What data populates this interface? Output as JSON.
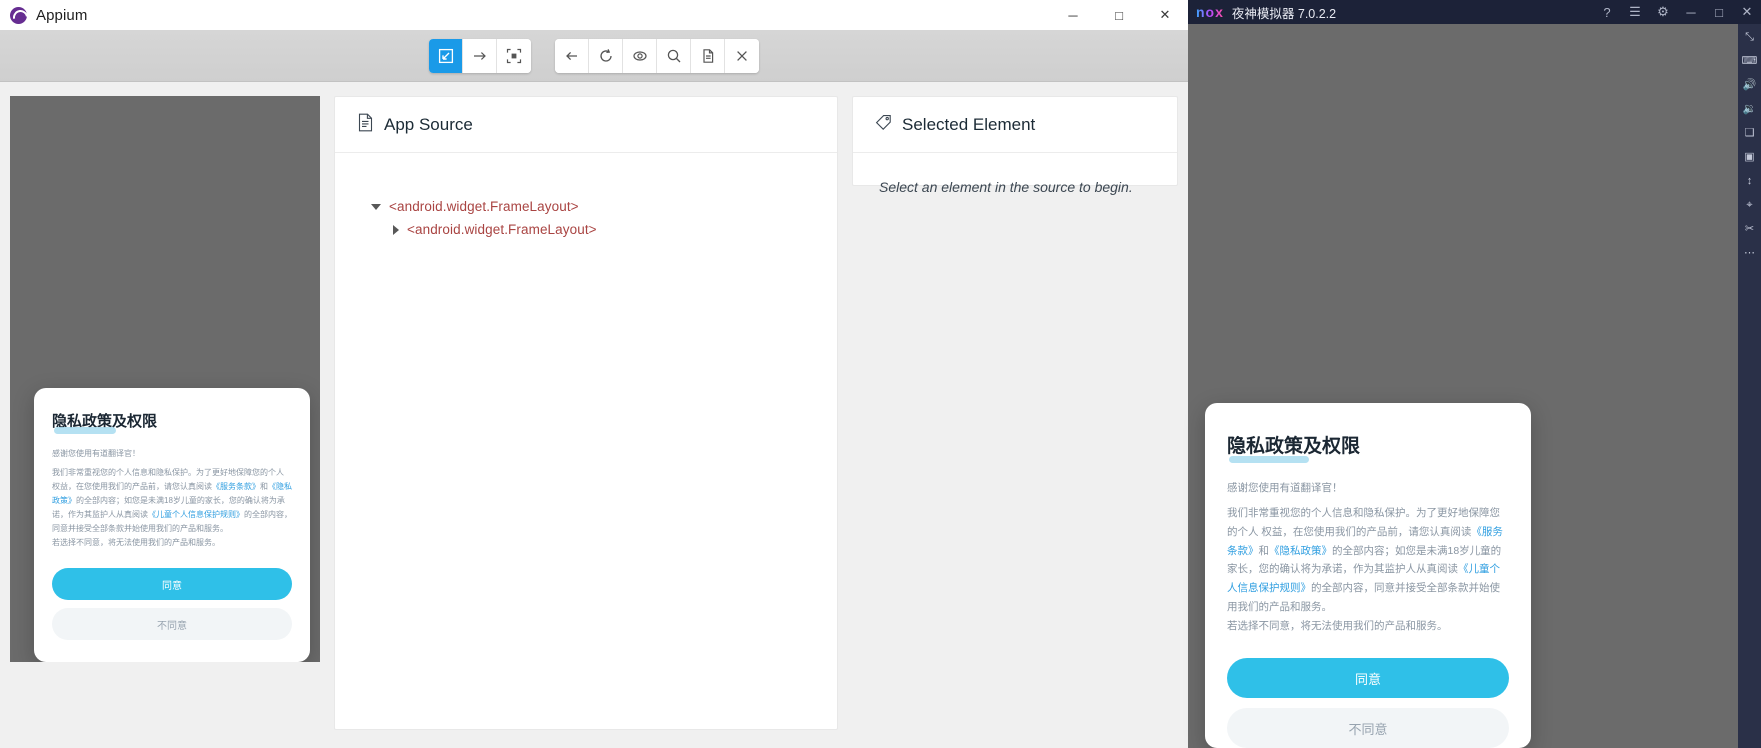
{
  "appium": {
    "window_title": "Appium",
    "logo_icon": "appium-logo-icon",
    "window_controls": {
      "minimize": "─",
      "maximize": "□",
      "close": "✕"
    },
    "toolbar": {
      "groups": [
        [
          {
            "name": "select-element-button",
            "icon": "select-arrow-icon",
            "active": true
          },
          {
            "name": "swipe-button",
            "icon": "arrow-right-icon",
            "active": false
          },
          {
            "name": "tap-by-coordinates-button",
            "icon": "crosshair-frame-icon",
            "active": false
          }
        ],
        [
          {
            "name": "back-button",
            "icon": "arrow-left-icon",
            "active": false
          },
          {
            "name": "refresh-source-button",
            "icon": "refresh-icon",
            "active": false
          },
          {
            "name": "toggle-visible-button",
            "icon": "eye-icon",
            "active": false
          },
          {
            "name": "search-element-button",
            "icon": "magnifier-icon",
            "active": false
          },
          {
            "name": "copy-source-button",
            "icon": "document-copy-icon",
            "active": false
          },
          {
            "name": "quit-session-button",
            "icon": "close-x-icon",
            "active": false
          }
        ]
      ]
    },
    "app_source": {
      "title": "App Source",
      "icon": "document-icon",
      "tree": [
        {
          "label": "<android.widget.FrameLayout>",
          "expanded": true,
          "level": 1
        },
        {
          "label": "<android.widget.FrameLayout>",
          "expanded": false,
          "level": 2
        }
      ]
    },
    "selected_element": {
      "title": "Selected Element",
      "icon": "tag-icon",
      "empty_message": "Select an element in the source to begin."
    }
  },
  "privacy_dialog": {
    "title": "隐私政策及权限",
    "thanks": "感谢您使用有道翻译官！",
    "body_line1": "我们非常重视您的个人信息和隐私保护。为了更好地保障您的个人",
    "body_line2": "权益，在您使用我们的产品前，请您认真阅读",
    "link1": "《服务条款》",
    "and1": "和",
    "link2": "《隐",
    "link2b": "私政策》",
    "body_line3": "的全部内容；如您是未满18岁儿童的家长，您的确认将为",
    "body_line4": "承诺，作为其监护人从真阅读",
    "link3": "《儿童个人信息保护规则》",
    "body_line5": "的全部内",
    "body_line6": "容，同意并接受全部条款并始使用我们的产品和服务。",
    "body_line7": "若选择不同意，将无法使用我们的产品和服务。",
    "agree_label": "同意",
    "disagree_label": "不同意",
    "accent_color": "#2fc0e8",
    "link_color": "#2f9ee0"
  },
  "nox": {
    "logo_text": "nox",
    "title": "夜神模拟器 7.0.2.2",
    "titlebar_icons": [
      {
        "name": "help-icon",
        "glyph": "?"
      },
      {
        "name": "menu-icon",
        "glyph": "☰"
      },
      {
        "name": "settings-gear-icon",
        "glyph": "⚙"
      },
      {
        "name": "minimize-icon",
        "glyph": "─"
      },
      {
        "name": "maximize-icon",
        "glyph": "□"
      },
      {
        "name": "close-icon",
        "glyph": "✕"
      }
    ],
    "sidebar_icons": [
      {
        "name": "fullscreen-icon",
        "glyph": "⤡"
      },
      {
        "name": "keyboard-icon",
        "glyph": "⌨"
      },
      {
        "name": "volume-up-icon",
        "glyph": "🔊"
      },
      {
        "name": "volume-down-icon",
        "glyph": "🔉"
      },
      {
        "name": "screenshot-icon",
        "glyph": "❑"
      },
      {
        "name": "video-record-icon",
        "glyph": "▣"
      },
      {
        "name": "shake-icon",
        "glyph": "↕"
      },
      {
        "name": "location-icon",
        "glyph": "⌖"
      },
      {
        "name": "scissors-icon",
        "glyph": "✂"
      },
      {
        "name": "more-icon",
        "glyph": "⋯"
      }
    ]
  }
}
